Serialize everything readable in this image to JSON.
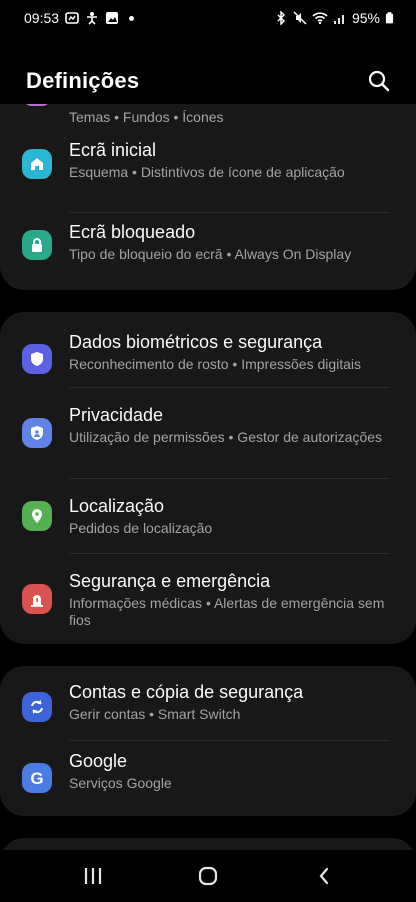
{
  "status": {
    "time": "09:53",
    "battery": "95%"
  },
  "header": {
    "title": "Definições"
  },
  "partial_top": {
    "subtitle": "Temas  •  Fundos  •  Ícones"
  },
  "items": [
    {
      "label": "Ecrã inicial",
      "sub": "Esquema  •  Distintivos de ícone de aplicação",
      "icon": "home-icon",
      "color": "#2bb6d6"
    },
    {
      "label": "Ecrã bloqueado",
      "sub": "Tipo de bloqueio do ecrã  •  Always On Display",
      "icon": "lock-icon",
      "color": "#2aa889"
    },
    {
      "label": "Dados biométricos e segurança",
      "sub": "Reconhecimento de rosto  •  Impressões digitais",
      "icon": "shield-icon",
      "color": "#5b61e0"
    },
    {
      "label": "Privacidade",
      "sub": "Utilização de permissões  •  Gestor de autorizações",
      "icon": "privacy-shield-icon",
      "color": "#5f83e6"
    },
    {
      "label": "Localização",
      "sub": "Pedidos de localização",
      "icon": "location-pin-icon",
      "color": "#54b050"
    },
    {
      "label": "Segurança e emergência",
      "sub": "Informações médicas  •  Alertas de emergência sem fios",
      "icon": "emergency-icon",
      "color": "#d9534f"
    },
    {
      "label": "Contas e cópia de segurança",
      "sub": "Gerir contas  •  Smart Switch",
      "icon": "sync-icon",
      "color": "#3d64d8"
    },
    {
      "label": "Google",
      "sub": "Serviços Google",
      "icon": "google-icon",
      "color": "#4a7de4"
    }
  ]
}
